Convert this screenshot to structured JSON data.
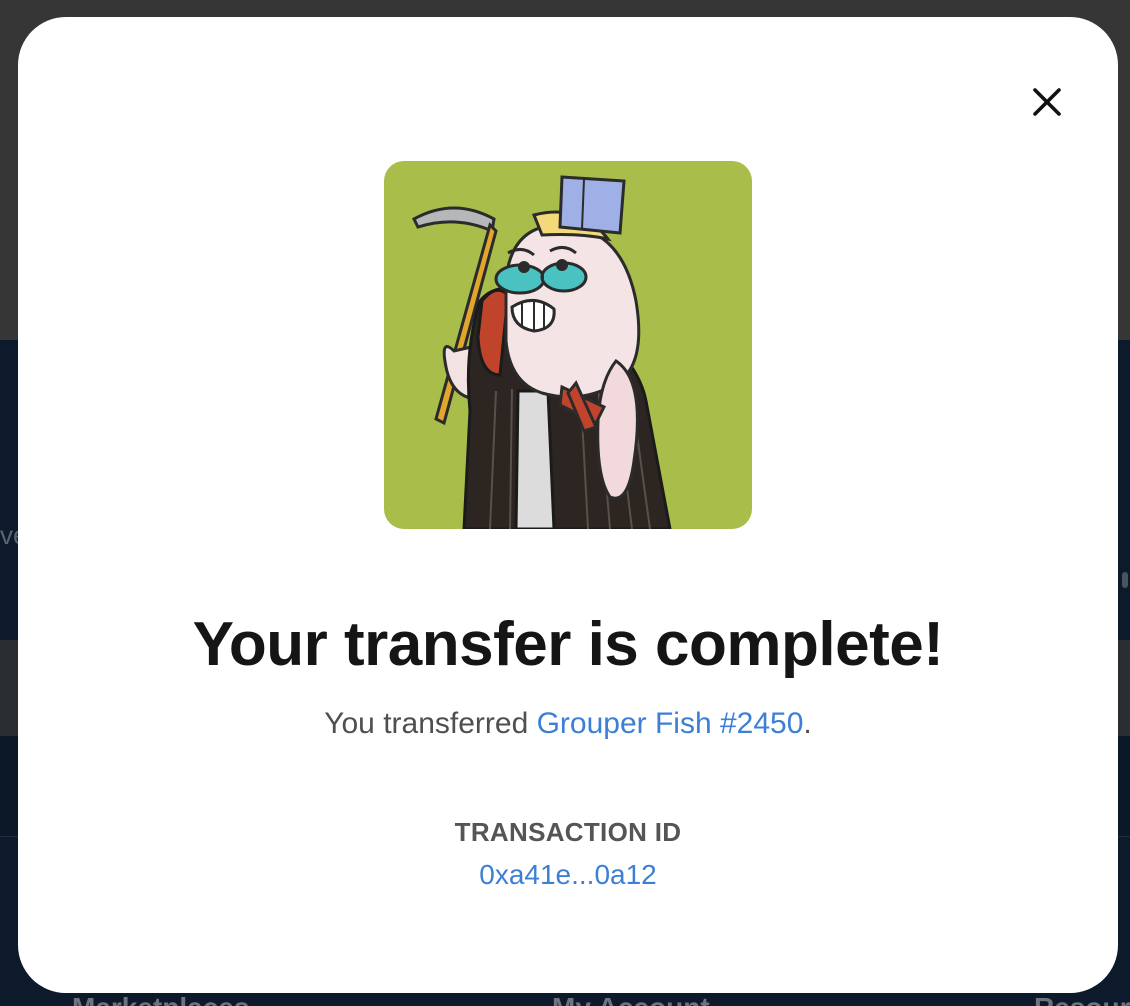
{
  "modal": {
    "close_icon": "close-icon",
    "nft_image": {
      "alt": "Grouper Fish #2450",
      "background_color": "#a9bd4a"
    },
    "headline": "Your transfer is complete!",
    "subline_prefix": "You transferred ",
    "nft_name": "Grouper Fish #2450",
    "subline_suffix": ".",
    "transaction_label": "TRANSACTION ID",
    "transaction_id": "0xa41e...0a12"
  },
  "background": {
    "footer_links": [
      "Marketplaces",
      "My Account",
      "Resources"
    ]
  },
  "colors": {
    "link": "#3d7fd6",
    "headline": "#151515",
    "modal_bg": "#ffffff"
  }
}
